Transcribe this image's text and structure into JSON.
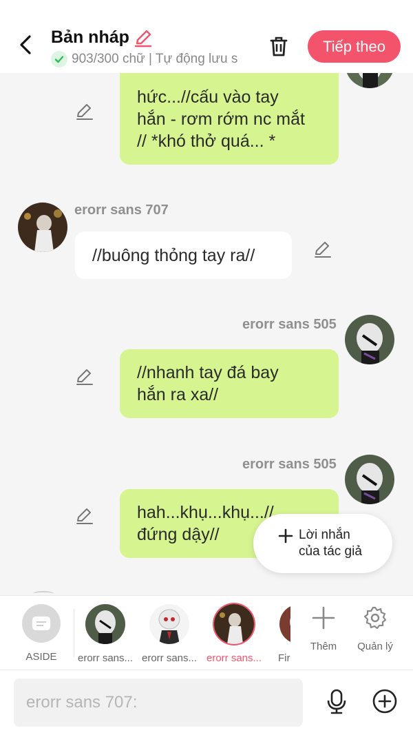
{
  "header": {
    "title": "Bản nháp",
    "status": "903/300 chữ | Tự động lưu s",
    "next_label": "Tiếp theo"
  },
  "messages": [
    {
      "side": "right",
      "text": [
        "hức...//cấu vào tay",
        "hắn - rơm rớm nc mắt",
        "// *khó thở quá... *"
      ]
    },
    {
      "side": "left",
      "sender": "erorr sans 707",
      "text": [
        "//buông thỏng tay ra//"
      ]
    },
    {
      "side": "right",
      "sender": "erorr sans 505",
      "text": [
        "//nhanh tay đá bay",
        "hắn ra xa//"
      ]
    },
    {
      "side": "right",
      "sender": "erorr sans 505",
      "text": [
        "hah...khụ...khụ...//",
        "đứng dậy//"
      ]
    }
  ],
  "author_note": {
    "line1": "Lời nhắn",
    "line2": "của tác giả"
  },
  "characters": [
    {
      "label": "ASIDE"
    },
    {
      "label": "erorr sans..."
    },
    {
      "label": "erorr sans..."
    },
    {
      "label": "erorr sans...",
      "active": true
    },
    {
      "label": "Fir"
    }
  ],
  "tools": {
    "add_label": "Thêm",
    "manage_label": "Quản lý"
  },
  "input": {
    "placeholder": "erorr sans 707:"
  },
  "colors": {
    "accent": "#f3546c",
    "bubble_green": "#d6f590",
    "background": "#f5f5f5"
  }
}
